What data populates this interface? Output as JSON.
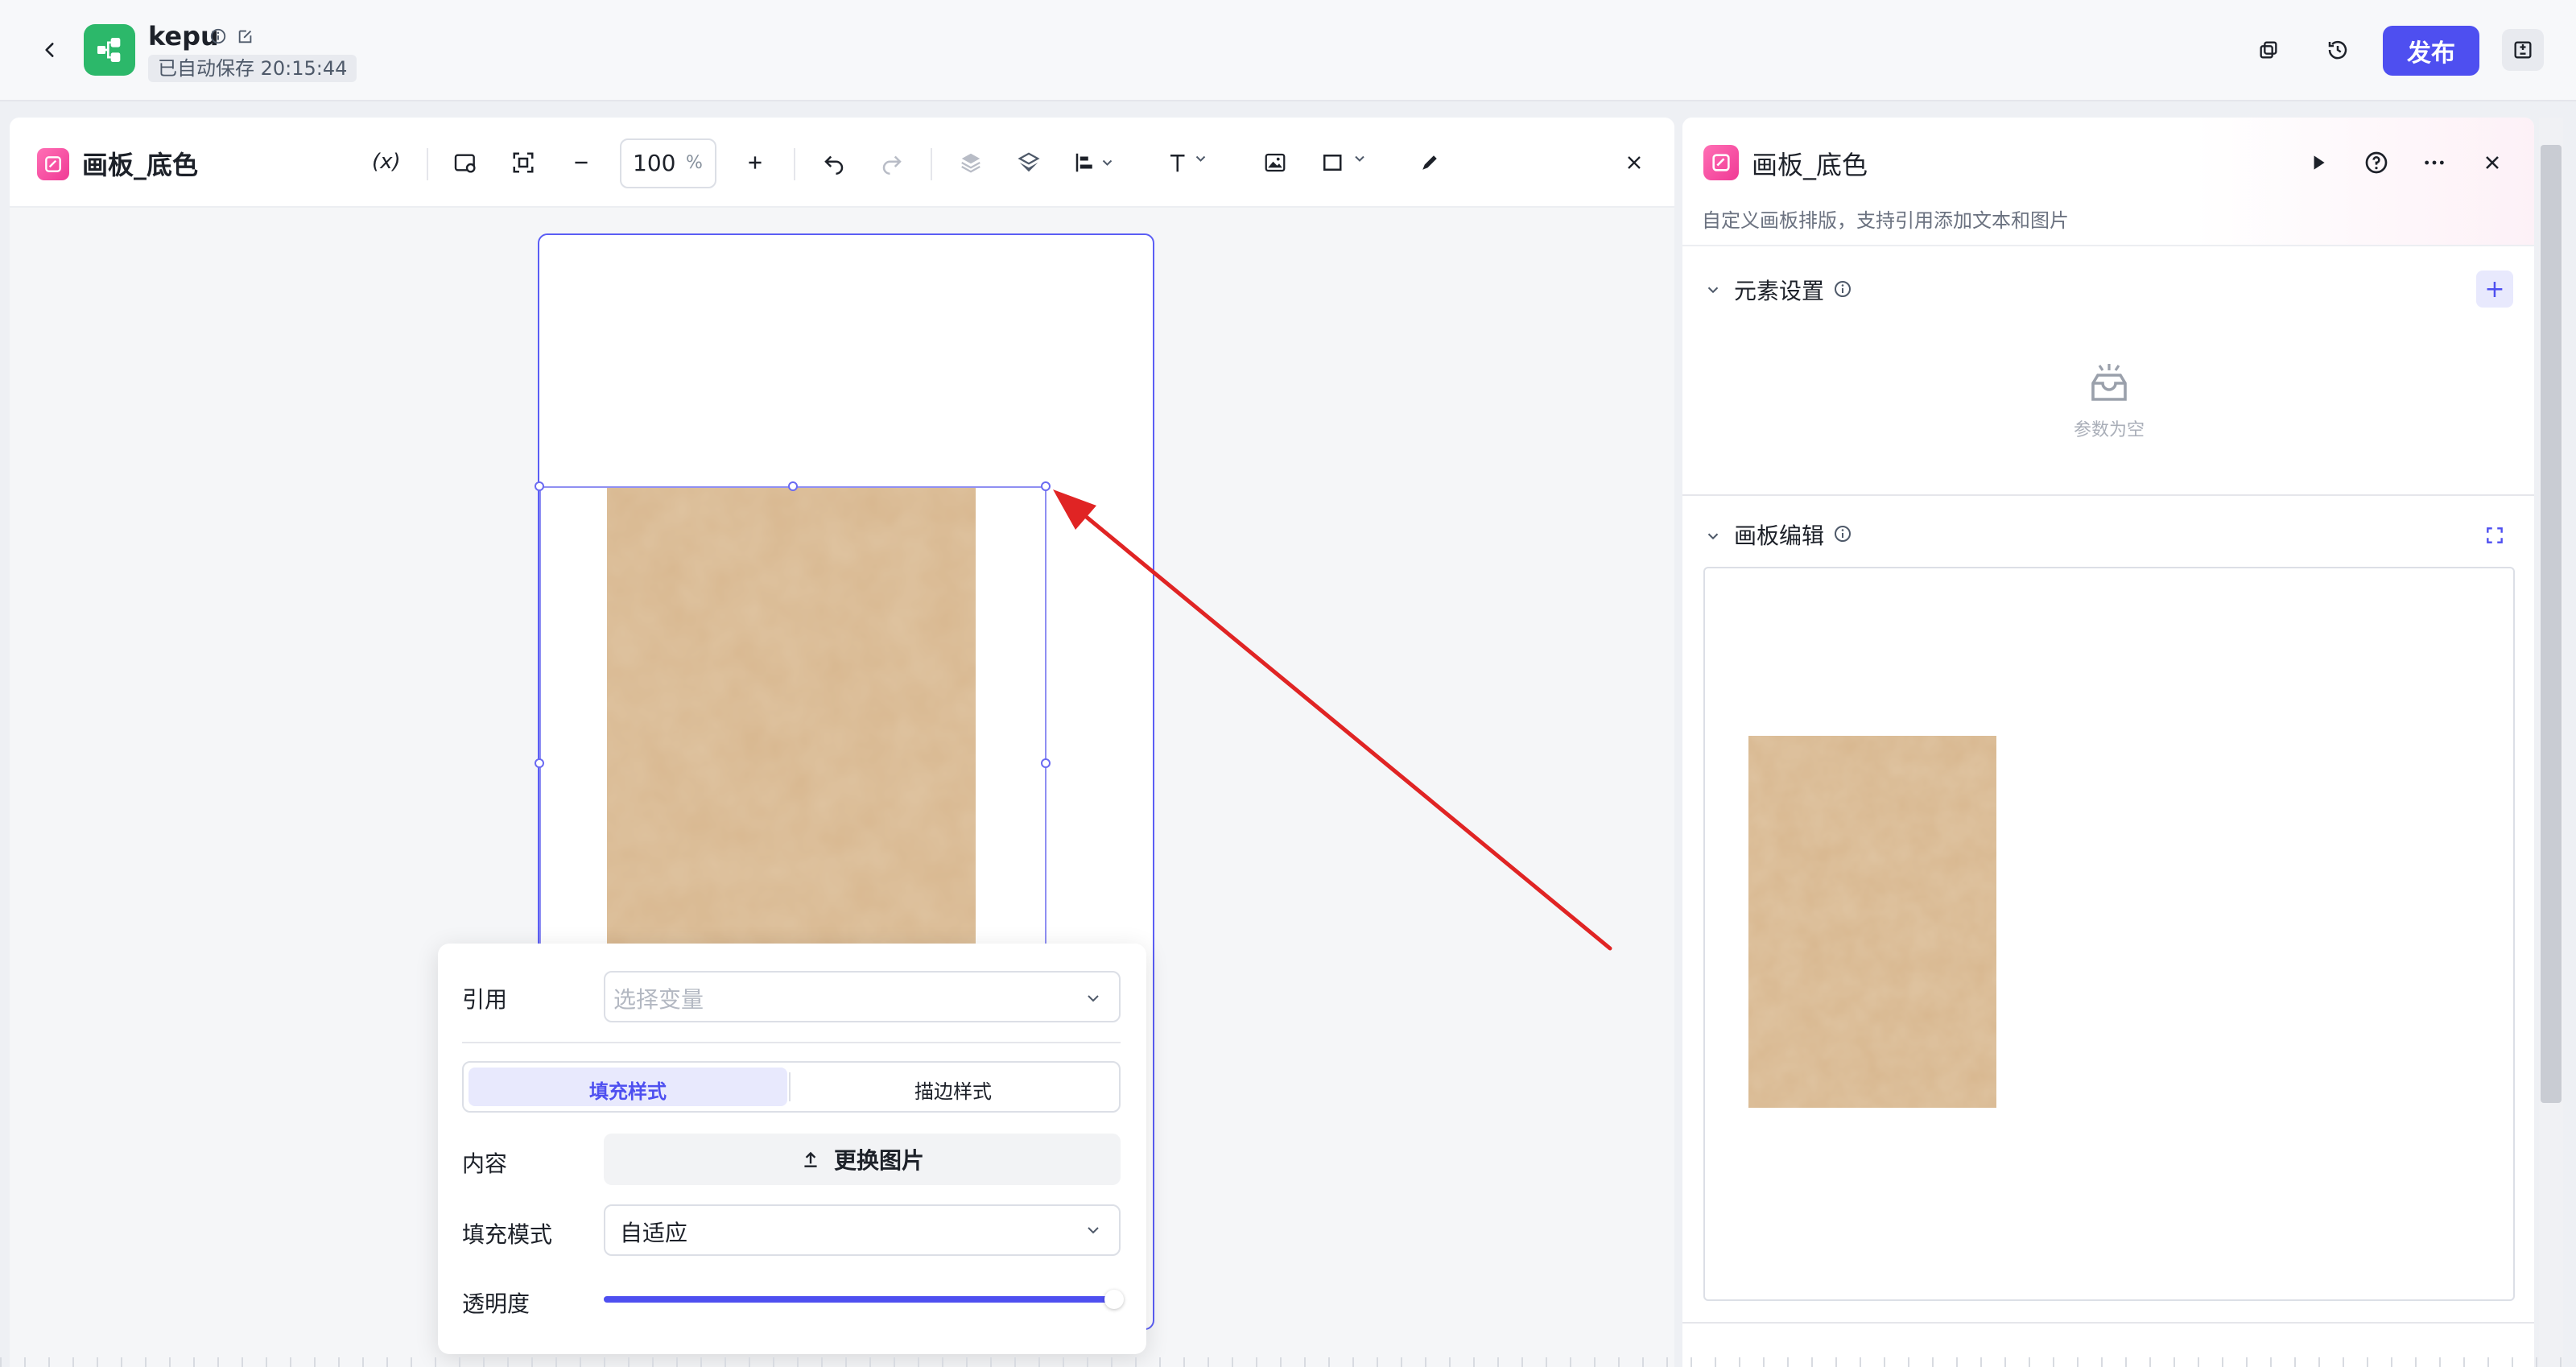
{
  "header": {
    "app_name": "kepu",
    "autosave": "已自动保存 20:15:44",
    "publish_label": "发布"
  },
  "editor": {
    "title": "画板_底色",
    "variable_label": "(x)",
    "zoom_value": "100",
    "zoom_unit": "%"
  },
  "popover": {
    "reference_label": "引用",
    "reference_placeholder": "选择变量",
    "tabs": [
      "填充样式",
      "描边样式"
    ],
    "active_tab": 0,
    "content_label": "内容",
    "replace_image_label": "更换图片",
    "fill_mode_label": "填充模式",
    "fill_mode_value": "自适应",
    "opacity_label": "透明度",
    "opacity_value": 1.0
  },
  "right_panel": {
    "title": "画板_底色",
    "description": "自定义画板排版，支持引用添加文本和图片",
    "sections": {
      "elements": {
        "title": "元素设置",
        "empty_text": "参数为空"
      },
      "canvas": {
        "title": "画板编辑"
      }
    }
  },
  "colors": {
    "accent": "#4e4ff0",
    "brand_green": "#2cb86a",
    "canvas_pink": "#f03a95",
    "kraft": "#d8b78f",
    "arrow_red": "#e02424"
  }
}
